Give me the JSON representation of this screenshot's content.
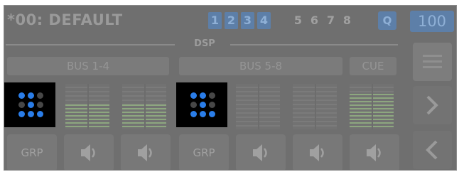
{
  "header": {
    "title": "*00: DEFAULT",
    "banks_active": [
      "1",
      "2",
      "3",
      "4"
    ],
    "banks_inactive": [
      "5",
      "6",
      "7",
      "8"
    ],
    "q_label": "Q",
    "level": "100"
  },
  "section": {
    "label": "DSP"
  },
  "tabs": {
    "bus_1_4": "BUS 1-4",
    "bus_5_8": "BUS 5-8",
    "cue": "CUE"
  },
  "grid_dots": [
    "on",
    "on",
    "off",
    "off",
    "on",
    "off",
    "on",
    "on",
    "on"
  ],
  "meters": [
    {
      "level": 0.55
    },
    {
      "level": 0.55
    },
    {
      "level": 0.0
    },
    {
      "level": 0.0
    },
    {
      "level": 0.78
    }
  ],
  "bottom": {
    "grp": "GRP"
  },
  "icons": {
    "menu": "hamburger-menu-icon",
    "next": "chevron-right-icon",
    "prev": "chevron-left-icon",
    "speaker": "speaker-icon",
    "grid": "dot-grid-icon"
  },
  "colors": {
    "accent": "#5d7fa8",
    "dot_on": "#2a7de8",
    "meter": "#8da77f"
  }
}
